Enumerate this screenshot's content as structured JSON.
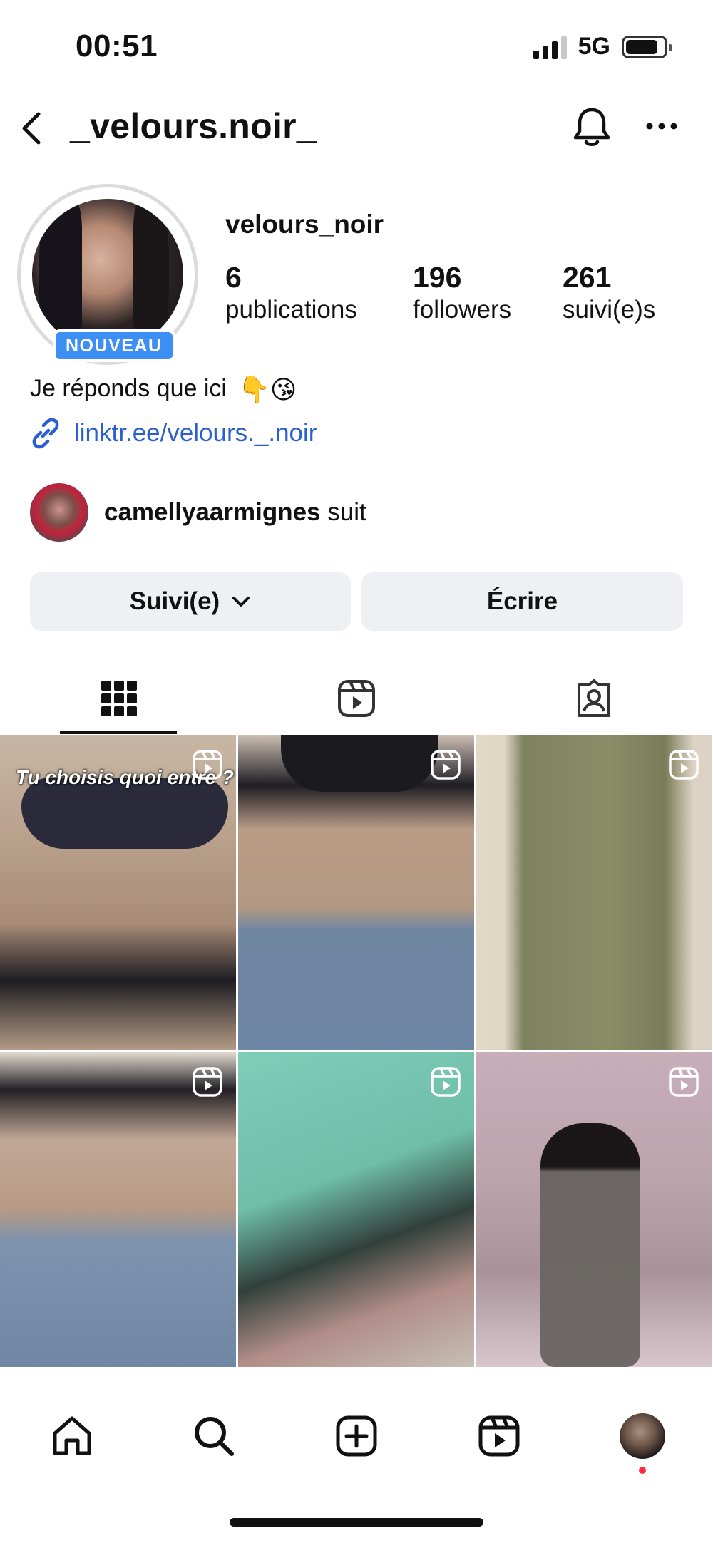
{
  "status_bar": {
    "time": "00:51",
    "network": "5G",
    "signal_bars": 4,
    "signal_active": 3,
    "battery_level": 0.85
  },
  "header": {
    "title": "_velours.noir_"
  },
  "profile": {
    "display_name": "velours_noir",
    "badge": "NOUVEAU",
    "stats": [
      {
        "value": "6",
        "label": "publications"
      },
      {
        "value": "196",
        "label": "followers"
      },
      {
        "value": "261",
        "label": "suivi(e)s"
      }
    ],
    "bio": "Je réponds que ici",
    "bio_emojis": "👇😘",
    "link": "linktr.ee/velours._.noir",
    "mutual": {
      "name": "camellyaarmignes",
      "suffix": "suit"
    }
  },
  "actions": {
    "follow_label": "Suivi(e)",
    "message_label": "Écrire"
  },
  "tabs": [
    {
      "name": "grid",
      "icon": "grid-icon",
      "active": true
    },
    {
      "name": "reels",
      "icon": "reels-icon",
      "active": false
    },
    {
      "name": "tagged",
      "icon": "tagged-icon",
      "active": false
    }
  ],
  "posts": [
    {
      "type": "reel",
      "caption": "Tu choisis quoi entre ?"
    },
    {
      "type": "reel",
      "caption": ""
    },
    {
      "type": "reel",
      "caption": ""
    },
    {
      "type": "reel",
      "caption": ""
    },
    {
      "type": "reel",
      "caption": ""
    },
    {
      "type": "reel",
      "caption": ""
    }
  ],
  "bottom_nav": [
    {
      "name": "home",
      "icon": "home-icon"
    },
    {
      "name": "search",
      "icon": "search-icon"
    },
    {
      "name": "create",
      "icon": "create-icon"
    },
    {
      "name": "reels",
      "icon": "reels-icon"
    },
    {
      "name": "profile",
      "icon": "profile-avatar"
    }
  ],
  "colors": {
    "accent_link": "#2b5ed1",
    "badge": "#3d8ef5",
    "button_bg": "#eff0f3",
    "notification_dot": "#ff2a40"
  }
}
